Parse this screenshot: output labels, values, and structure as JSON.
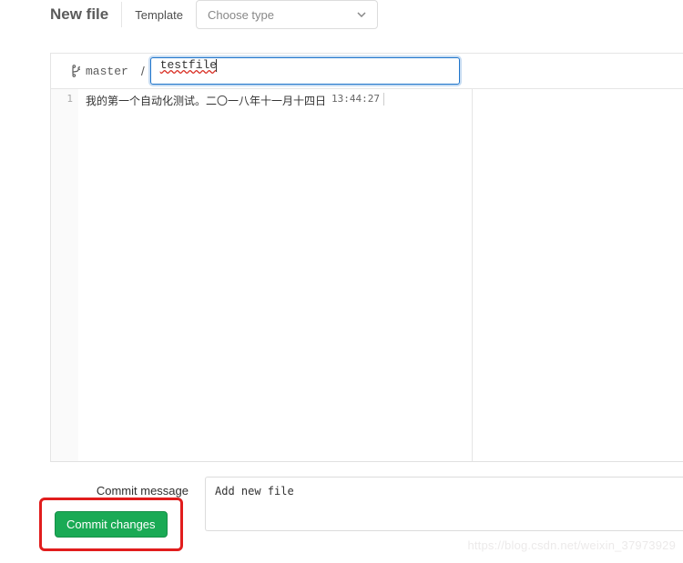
{
  "header": {
    "title": "New file",
    "template_label": "Template",
    "template_placeholder": "Choose type"
  },
  "filebar": {
    "branch": "master",
    "separator": "/",
    "filename": "testfile"
  },
  "editor": {
    "gutter": [
      "1"
    ],
    "lines": [
      {
        "text": "我的第一个自动化测试。二〇一八年十一月十四日",
        "time": "13:44:27"
      }
    ]
  },
  "commit": {
    "label": "Commit message",
    "message": "Add new file",
    "button": "Commit changes"
  },
  "watermark": "https://blog.csdn.net/weixin_37973929"
}
